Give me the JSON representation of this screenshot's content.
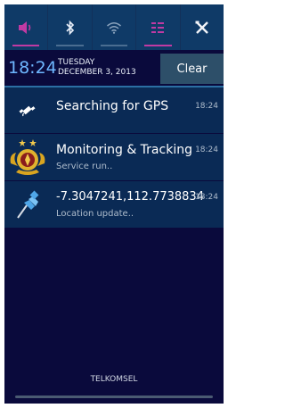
{
  "quick_settings": {
    "toggles": [
      {
        "name": "sound-toggle",
        "icon": "volume-icon",
        "active": true,
        "accent": "#c03aa3"
      },
      {
        "name": "bluetooth-toggle",
        "icon": "bluetooth-icon",
        "active": false
      },
      {
        "name": "wifi-toggle",
        "icon": "wifi-icon",
        "active": false
      },
      {
        "name": "data-toggle",
        "icon": "data-list-icon",
        "active": true,
        "accent": "#c03aa3"
      },
      {
        "name": "settings-toggle",
        "icon": "tools-icon",
        "active": false
      }
    ]
  },
  "datebar": {
    "time": "18:24",
    "day": "TUESDAY",
    "date": "DECEMBER 3, 2013",
    "clear_label": "Clear"
  },
  "notifications": [
    {
      "title": "Searching for GPS",
      "subtitle": "",
      "time": "18:24",
      "icon": "gps-satellite-icon"
    },
    {
      "title": "Monitoring & Tracking",
      "subtitle": "Service run..",
      "time": "18:24",
      "icon": "police-emblem-icon"
    },
    {
      "title": "-7.3047241,112.7738834",
      "subtitle": "Location update..",
      "time": "18:24",
      "icon": "pushpin-icon"
    }
  ],
  "carrier": "TELKOMSEL",
  "colors": {
    "panel_bg": "#0a0a3c",
    "toggle_bg": "#0f3a67",
    "notification_bg": "#0a2a55",
    "time_color": "#6eb7ff",
    "accent": "#c03aa3"
  }
}
